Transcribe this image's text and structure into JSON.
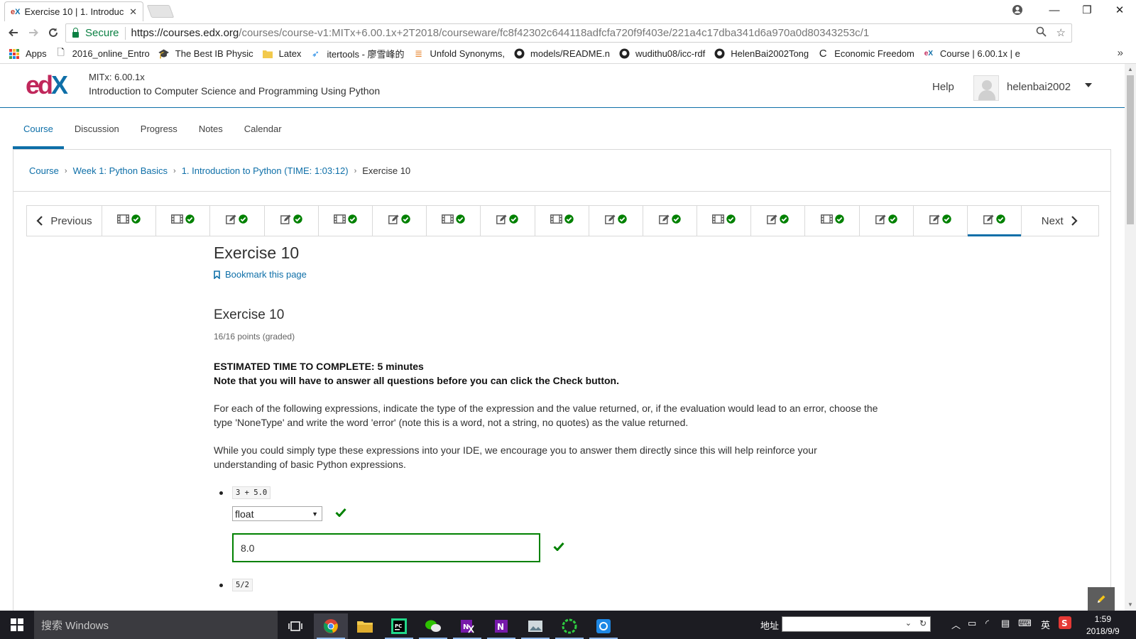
{
  "browser": {
    "tab_title": "Exercise 10 | 1. Introduc",
    "tab_favicon": "edX",
    "secure_label": "Secure",
    "url_host": "https://courses.edx.org",
    "url_path": "/courses/course-v1:MITx+6.00.1x+2T2018/courseware/fc8f42302c644118adfcfa720f9f403e/221a4c17dba341d6a970a0d80343253c/1",
    "bookmarks": [
      {
        "label": "Apps",
        "icon": "apps-grid-icon"
      },
      {
        "label": "2016_online_Entro",
        "icon": "page-icon"
      },
      {
        "label": "The Best IB Physic",
        "icon": "graduation-cap-icon"
      },
      {
        "label": "Latex",
        "icon": "folder-icon"
      },
      {
        "label": "itertools - 廖雪峰的",
        "icon": "rocket-icon"
      },
      {
        "label": "Unfold Synonyms,",
        "icon": "stack-icon"
      },
      {
        "label": "models/README.n",
        "icon": "github-icon"
      },
      {
        "label": "wudithu08/icc-rdf",
        "icon": "github-icon"
      },
      {
        "label": "HelenBai2002Tong",
        "icon": "github-icon"
      },
      {
        "label": "Economic Freedom",
        "icon": "c-icon"
      },
      {
        "label": "Course | 6.00.1x | e",
        "icon": "edx-icon"
      }
    ]
  },
  "header": {
    "course_org": "MITx: 6.00.1x",
    "course_name": "Introduction to Computer Science and Programming Using Python",
    "help": "Help",
    "username": "helenbai2002"
  },
  "course_tabs": [
    {
      "label": "Course",
      "active": true
    },
    {
      "label": "Discussion",
      "active": false
    },
    {
      "label": "Progress",
      "active": false
    },
    {
      "label": "Notes",
      "active": false
    },
    {
      "label": "Calendar",
      "active": false
    }
  ],
  "breadcrumb": {
    "items": [
      "Course",
      "Week 1: Python Basics",
      "1. Introduction to Python (TIME: 1:03:12)"
    ],
    "current": "Exercise 10"
  },
  "sequence": {
    "previous": "Previous",
    "next": "Next",
    "items": [
      "video",
      "video",
      "problem",
      "problem",
      "video",
      "problem",
      "video",
      "problem",
      "video",
      "problem",
      "problem",
      "video",
      "problem",
      "video",
      "problem",
      "problem",
      "problem"
    ],
    "completed": true,
    "active_index": 16
  },
  "unit": {
    "title": "Exercise 10",
    "bookmark": "Bookmark this page",
    "problem_title": "Exercise 10",
    "points": "16/16 points (graded)",
    "estimated_time": "ESTIMATED TIME TO COMPLETE: 5 minutes",
    "note": "Note that you will have to answer all questions before you can click the Check button.",
    "para1": "For each of the following expressions, indicate the type of the expression and the value returned, or, if the evaluation would lead to an error, choose the type 'NoneType' and write the word 'error' (note this is a word, not a string, no quotes) as the value returned.",
    "para2": "While you could simply type these expressions into your IDE, we encourage you to answer them directly since this will help reinforce your understanding of basic Python expressions.",
    "questions": [
      {
        "expression": "3 + 5.0",
        "type": "float",
        "value": "8.0"
      },
      {
        "expression": "5/2"
      }
    ]
  },
  "colors": {
    "edx_blue": "#0e6fa8",
    "edx_magenta": "#c0275b",
    "correct_green": "#008100"
  },
  "taskbar": {
    "search_placeholder": "搜索 Windows",
    "address_label": "地址",
    "ime": "英",
    "time": "1:59",
    "date": "2018/9/9"
  }
}
